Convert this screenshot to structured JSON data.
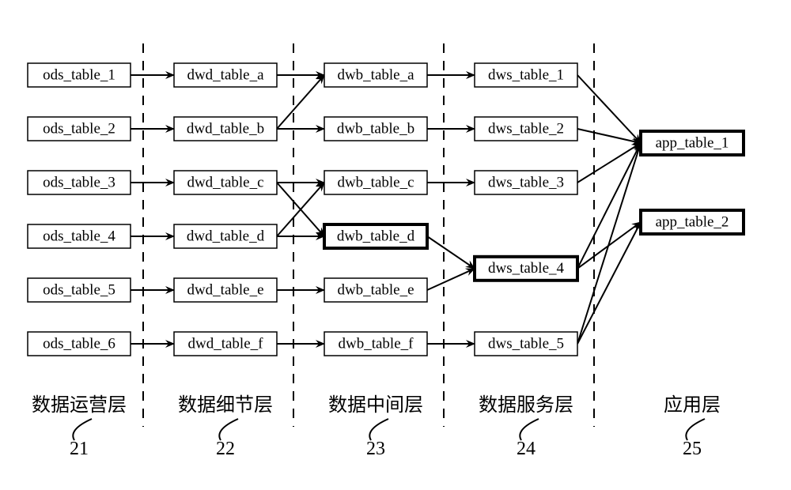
{
  "layers": [
    {
      "id": "ods",
      "label": "数据运营层",
      "num": "21"
    },
    {
      "id": "dwd",
      "label": "数据细节层",
      "num": "22"
    },
    {
      "id": "dwb",
      "label": "数据中间层",
      "num": "23"
    },
    {
      "id": "dws",
      "label": "数据服务层",
      "num": "24"
    },
    {
      "id": "app",
      "label": "应用层",
      "num": "25"
    }
  ],
  "nodes": {
    "ods": [
      {
        "text": "ods_table_1"
      },
      {
        "text": "ods_table_2"
      },
      {
        "text": "ods_table_3"
      },
      {
        "text": "ods_table_4"
      },
      {
        "text": "ods_table_5"
      },
      {
        "text": "ods_table_6"
      }
    ],
    "dwd": [
      {
        "text": "dwd_table_a"
      },
      {
        "text": "dwd_table_b"
      },
      {
        "text": "dwd_table_c"
      },
      {
        "text": "dwd_table_d"
      },
      {
        "text": "dwd_table_e"
      },
      {
        "text": "dwd_table_f"
      }
    ],
    "dwb": [
      {
        "text": "dwb_table_a"
      },
      {
        "text": "dwb_table_b"
      },
      {
        "text": "dwb_table_c"
      },
      {
        "text": "dwb_table_d",
        "bold": true
      },
      {
        "text": "dwb_table_e"
      },
      {
        "text": "dwb_table_f"
      }
    ],
    "dws": [
      {
        "text": "dws_table_1"
      },
      {
        "text": "dws_table_2"
      },
      {
        "text": "dws_table_3"
      },
      {
        "text": "dws_table_4",
        "bold": true
      },
      {
        "text": "dws_table_5"
      }
    ],
    "app": [
      {
        "text": "app_table_1",
        "bold": true
      },
      {
        "text": "app_table_2",
        "bold": true
      }
    ]
  },
  "edges": [
    [
      "ods.0",
      "dwd.0"
    ],
    [
      "ods.1",
      "dwd.1"
    ],
    [
      "ods.2",
      "dwd.2"
    ],
    [
      "ods.3",
      "dwd.3"
    ],
    [
      "ods.4",
      "dwd.4"
    ],
    [
      "ods.5",
      "dwd.5"
    ],
    [
      "dwd.0",
      "dwb.0"
    ],
    [
      "dwd.1",
      "dwb.0"
    ],
    [
      "dwd.1",
      "dwb.1"
    ],
    [
      "dwd.2",
      "dwb.2"
    ],
    [
      "dwd.2",
      "dwb.3"
    ],
    [
      "dwd.3",
      "dwb.2"
    ],
    [
      "dwd.3",
      "dwb.3"
    ],
    [
      "dwd.4",
      "dwb.4"
    ],
    [
      "dwd.5",
      "dwb.5"
    ],
    [
      "dwb.0",
      "dws.0"
    ],
    [
      "dwb.1",
      "dws.1"
    ],
    [
      "dwb.2",
      "dws.2"
    ],
    [
      "dwb.3",
      "dws.3"
    ],
    [
      "dwb.4",
      "dws.3"
    ],
    [
      "dwb.5",
      "dws.4"
    ],
    [
      "dws.0",
      "app.0"
    ],
    [
      "dws.1",
      "app.0"
    ],
    [
      "dws.2",
      "app.0"
    ],
    [
      "dws.3",
      "app.0"
    ],
    [
      "dws.3",
      "app.1"
    ],
    [
      "dws.4",
      "app.0"
    ],
    [
      "dws.4",
      "app.1"
    ]
  ],
  "chart_data": {
    "type": "table",
    "title": "Data warehouse layer flow diagram",
    "layers": [
      "数据运营层",
      "数据细节层",
      "数据中间层",
      "数据服务层",
      "应用层"
    ],
    "layer_ids": [
      21,
      22,
      23,
      24,
      25
    ],
    "nodes_per_layer": {
      "数据运营层": [
        "ods_table_1",
        "ods_table_2",
        "ods_table_3",
        "ods_table_4",
        "ods_table_5",
        "ods_table_6"
      ],
      "数据细节层": [
        "dwd_table_a",
        "dwd_table_b",
        "dwd_table_c",
        "dwd_table_d",
        "dwd_table_e",
        "dwd_table_f"
      ],
      "数据中间层": [
        "dwb_table_a",
        "dwb_table_b",
        "dwb_table_c",
        "dwb_table_d",
        "dwb_table_e",
        "dwb_table_f"
      ],
      "数据服务层": [
        "dws_table_1",
        "dws_table_2",
        "dws_table_3",
        "dws_table_4",
        "dws_table_5"
      ],
      "应用层": [
        "app_table_1",
        "app_table_2"
      ]
    },
    "highlighted": [
      "dwb_table_d",
      "dws_table_4",
      "app_table_1",
      "app_table_2"
    ],
    "edges": "see top-level edges key"
  }
}
